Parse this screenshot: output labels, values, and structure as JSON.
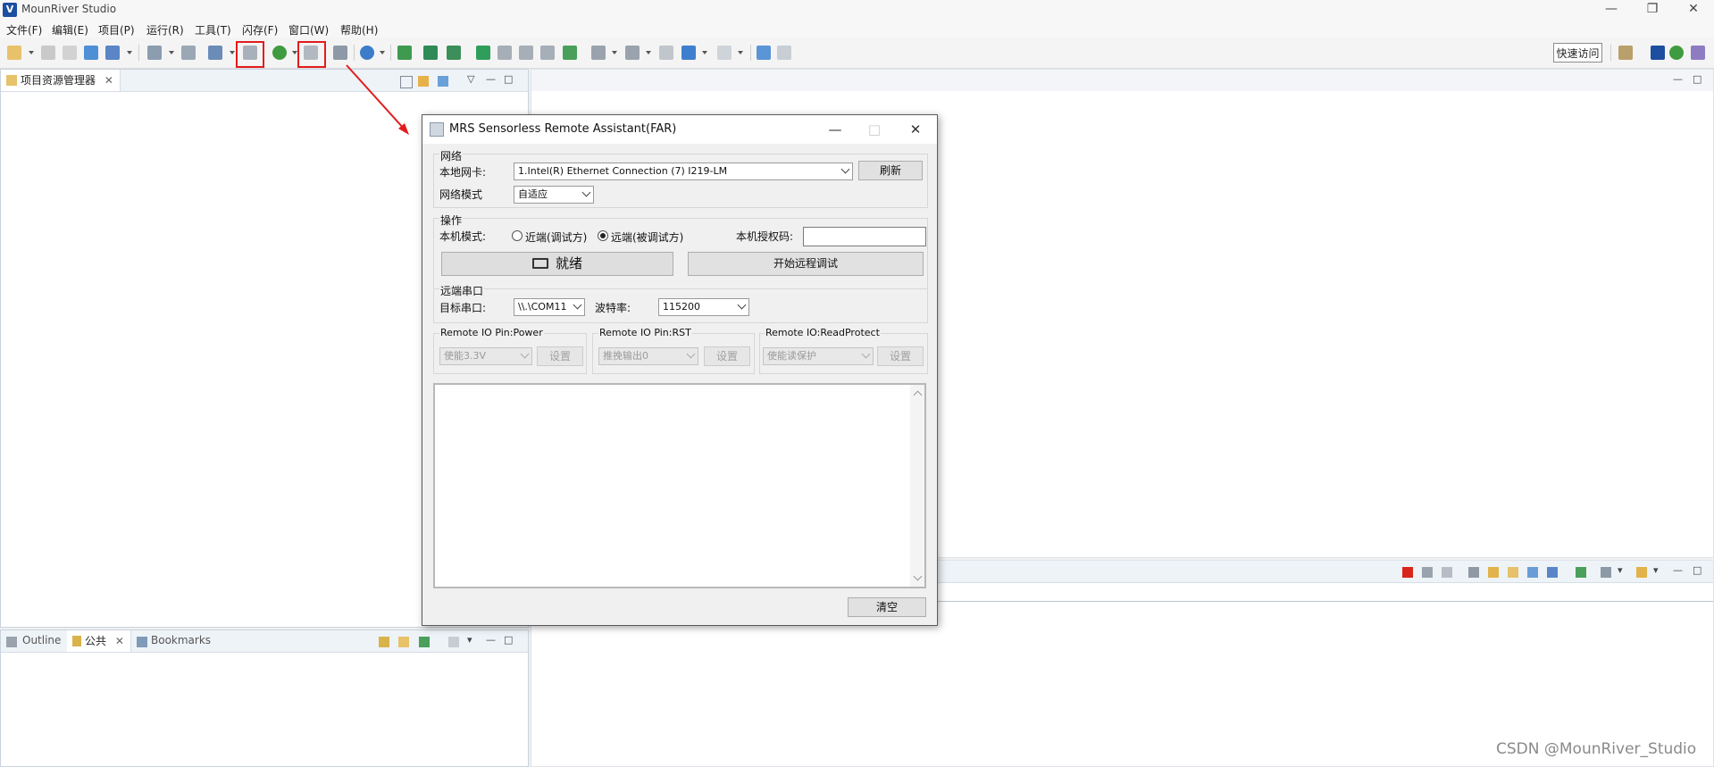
{
  "window": {
    "title": "MounRiver Studio",
    "logo_letter": "V",
    "minimize": "—",
    "restore": "❐",
    "close": "✕"
  },
  "menu": [
    {
      "label": "文件(F)"
    },
    {
      "label": "编辑(E)"
    },
    {
      "label": "项目(P)"
    },
    {
      "label": "运行(R)"
    },
    {
      "label": "工具(T)"
    },
    {
      "label": "闪存(F)"
    },
    {
      "label": "窗口(W)"
    },
    {
      "label": "帮助(H)"
    }
  ],
  "toolbar": {
    "quick_access": "快速访问",
    "highlight_color": "#e21c1c"
  },
  "left_panel": {
    "tab_label": "项目资源管理器"
  },
  "bottom_left_panel": {
    "tabs": [
      {
        "label": "Outline",
        "active": false
      },
      {
        "label": "公共",
        "active": true
      },
      {
        "label": "Bookmarks",
        "active": false
      }
    ]
  },
  "dialog": {
    "title": "MRS Sensorless Remote Assistant(FAR)",
    "network": {
      "group_label": "网络",
      "nic_label": "本地网卡:",
      "nic_value": "1.Intel(R) Ethernet Connection (7) I219-LM",
      "refresh_button": "刷新",
      "mode_label": "网络模式",
      "mode_value": "自适应"
    },
    "operation": {
      "group_label": "操作",
      "local_mode_label": "本机模式:",
      "radio_near": "近端(调试方)",
      "radio_far": "远端(被调试方)",
      "selected_mode": "far",
      "auth_code_label": "本机授权码:",
      "auth_code_value": "",
      "status_button": "就绪",
      "start_button": "开始远程调试"
    },
    "serial": {
      "group_label": "远端串口",
      "port_label": "目标串口:",
      "port_value": "\\\\.\\COM11",
      "baud_label": "波特率:",
      "baud_value": "115200"
    },
    "pins": [
      {
        "group_label": "Remote IO Pin:Power",
        "value": "使能3.3V",
        "button": "设置"
      },
      {
        "group_label": "Remote IO Pin:RST",
        "value": "推挽输出0",
        "button": "设置"
      },
      {
        "group_label": "Remote IO:ReadProtect",
        "value": "使能读保护",
        "button": "设置"
      }
    ],
    "log_text": "",
    "clear_button": "清空"
  },
  "watermark": "CSDN @MounRiver_Studio"
}
